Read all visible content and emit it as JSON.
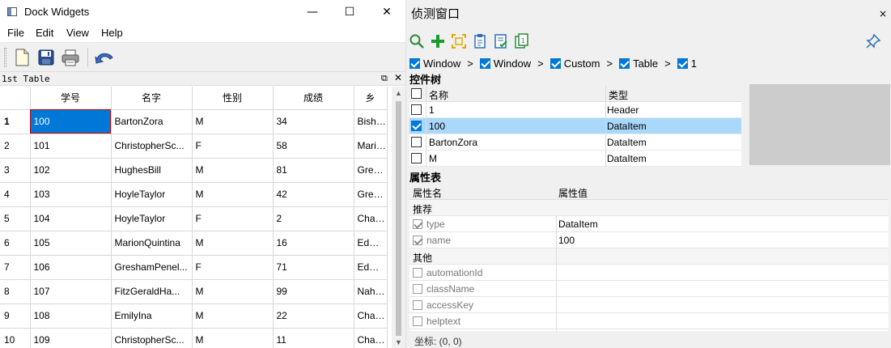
{
  "left_window": {
    "title": "Dock Widgets",
    "controls": {
      "minimize": "—",
      "maximize": "☐",
      "close": "✕"
    },
    "menu": [
      "File",
      "Edit",
      "View",
      "Help"
    ],
    "toolbar": [
      "new-document-icon",
      "save-icon",
      "print-icon",
      "undo-icon"
    ],
    "dock": {
      "title": "1st Table",
      "float": "⧉",
      "close": "✕"
    },
    "table": {
      "columns": [
        "",
        "学号",
        "名字",
        "性别",
        "成绩",
        "乡"
      ],
      "rows": [
        [
          "1",
          "100",
          "BartonZora",
          "M",
          "34",
          "Bishop"
        ],
        [
          "2",
          "101",
          "ChristopherSc...",
          "F",
          "58",
          "Marion"
        ],
        [
          "3",
          "102",
          "HughesBill",
          "M",
          "81",
          "Gresha"
        ],
        [
          "4",
          "103",
          "HoyleTaylor",
          "M",
          "42",
          "Gresha"
        ],
        [
          "5",
          "104",
          "HoyleTaylor",
          "F",
          "2",
          "Chauce"
        ],
        [
          "6",
          "105",
          "MarionQuintina",
          "M",
          "16",
          "Edmun"
        ],
        [
          "7",
          "106",
          "GreshamPenel...",
          "F",
          "71",
          "Edmun"
        ],
        [
          "8",
          "107",
          "FitzGeraldHa...",
          "M",
          "99",
          "Nahum"
        ],
        [
          "9",
          "108",
          "EmilyIna",
          "M",
          "22",
          "Chauce"
        ],
        [
          "10",
          "109",
          "ChristopherSc...",
          "M",
          "11",
          "Chauce"
        ]
      ]
    }
  },
  "right_window": {
    "title": "侦测窗口",
    "close": "×",
    "toolbar": [
      "search-icon",
      "add-icon",
      "target-icon",
      "clipboard-icon",
      "checklist-icon",
      "copy-icon"
    ],
    "pin": "pin-icon",
    "breadcrumb": [
      "Window",
      "Window",
      "Custom",
      "Table",
      "1"
    ],
    "breadcrumb_sep": ">",
    "tree_label": "控件树",
    "tree": {
      "col_name": "名称",
      "col_type": "类型",
      "rows": [
        {
          "name": "1",
          "type": "Header",
          "checked": false
        },
        {
          "name": "100",
          "type": "DataItem",
          "checked": true
        },
        {
          "name": "BartonZora",
          "type": "DataItem",
          "checked": false
        },
        {
          "name": "M",
          "type": "DataItem",
          "checked": false
        }
      ]
    },
    "props_label": "属性表",
    "props": {
      "col_key": "属性名",
      "col_value": "属性值",
      "group_recommended": "推荐",
      "recommended": [
        {
          "key": "type",
          "value": "DataItem",
          "checked": true
        },
        {
          "key": "name",
          "value": "100",
          "checked": true
        }
      ],
      "group_other": "其他",
      "other": [
        {
          "key": "automationId",
          "value": "",
          "checked": false
        },
        {
          "key": "className",
          "value": "",
          "checked": false
        },
        {
          "key": "accessKey",
          "value": "",
          "checked": false
        },
        {
          "key": "helptext",
          "value": "",
          "checked": false
        }
      ]
    },
    "status": "坐标: (0, 0)"
  }
}
